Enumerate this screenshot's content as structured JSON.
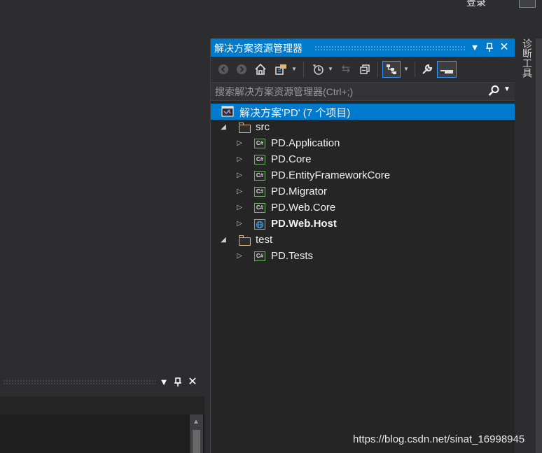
{
  "top": {
    "login": "登录"
  },
  "solution_explorer": {
    "title": "解决方案资源管理器",
    "search": {
      "placeholder": "搜索解决方案资源管理器(Ctrl+;)"
    },
    "tree": {
      "solution": "解决方案'PD' (7 个项目)",
      "folders": [
        {
          "label": "src",
          "projects": [
            "PD.Application",
            "PD.Core",
            "PD.EntityFrameworkCore",
            "PD.Migrator",
            "PD.Web.Core",
            "PD.Web.Host"
          ]
        },
        {
          "label": "test",
          "projects": [
            "PD.Tests"
          ]
        }
      ],
      "startup_project": "PD.Web.Host"
    }
  },
  "right_tabs": {
    "diagnostics": "诊断工具"
  },
  "watermark": "https://blog.csdn.net/sinat_16998945",
  "colors": {
    "accent": "#007acc",
    "background": "#2d2d30",
    "panel": "#252526",
    "cs_icon": "#72b06a",
    "folder_icon": "#dcb67a"
  }
}
